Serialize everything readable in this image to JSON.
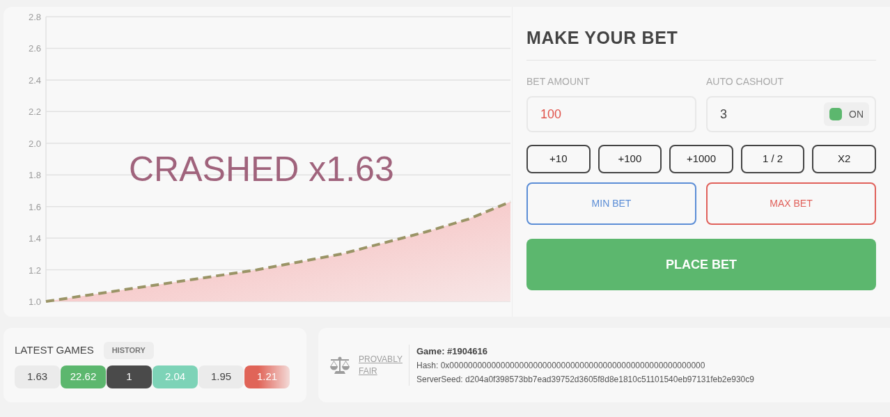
{
  "chart": {
    "status": "CRASHED x1.63",
    "chart_data": {
      "type": "area",
      "grid": true,
      "ylim": [
        1.0,
        2.8
      ],
      "yticks": [
        {
          "value": 1.0,
          "label": "1.0"
        },
        {
          "value": 1.2,
          "label": "1.2"
        },
        {
          "value": 1.4,
          "label": "1.4"
        },
        {
          "value": 1.6,
          "label": "1.6"
        },
        {
          "value": 1.8,
          "label": "1.8"
        },
        {
          "value": 2.0,
          "label": "2.0"
        },
        {
          "value": 2.2,
          "label": "2.2"
        },
        {
          "value": 2.4,
          "label": "2.4"
        },
        {
          "value": 2.6,
          "label": "2.6"
        },
        {
          "value": 2.8,
          "label": "2.8"
        }
      ],
      "series": [
        {
          "color": "#9a9466",
          "values": [
            1.0,
            1.04,
            1.08,
            1.12,
            1.16,
            1.2,
            1.25,
            1.3,
            1.37,
            1.44,
            1.52,
            1.63
          ]
        }
      ]
    }
  },
  "bet_panel": {
    "title": "MAKE YOUR BET",
    "bet_amount": {
      "label": "BET AMOUNT",
      "value": "100"
    },
    "auto_cashout": {
      "label": "AUTO CASHOUT",
      "value": "3",
      "toggle": {
        "label": "ON",
        "on": true
      }
    },
    "quick_buttons": [
      "+10",
      "+100",
      "+1000",
      "1 / 2",
      "X2"
    ],
    "min_bet": "MIN BET",
    "max_bet": "MAX BET",
    "place_bet": "PLACE BET"
  },
  "latest_games": {
    "title": "LATEST GAMES",
    "history_button": "HISTORY",
    "items": [
      {
        "value": "1.63",
        "color": "#ebebeb"
      },
      {
        "value": "22.62",
        "color": "#5cb76e"
      },
      {
        "value": "1",
        "color": "#4a4a4a"
      },
      {
        "value": "2.04",
        "color": "#7dd3b7"
      },
      {
        "value": "1.95",
        "color": "#ebebeb"
      },
      {
        "value": "1.21",
        "color": "#e06458"
      }
    ]
  },
  "fairness": {
    "link": "PROVABLY FAIR",
    "game": "Game: #1904616",
    "hash": "Hash: 0x0000000000000000000000000000000000000000000000000000000",
    "server_seed": "ServerSeed: d204a0f398573bb7ead39752d3605f8d8e1810c51101540eb97131feb2e930c9"
  }
}
